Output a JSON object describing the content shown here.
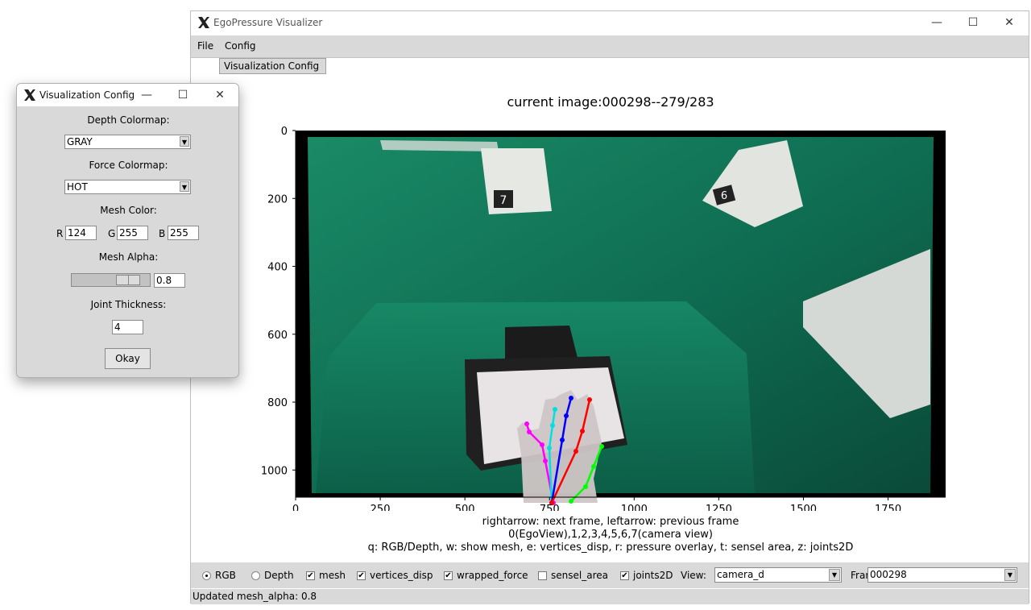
{
  "main_window": {
    "title": "EgoPressure Visualizer",
    "controls": {
      "minimize": "—",
      "maximize": "☐",
      "close": "✕"
    },
    "menu": [
      "File",
      "Config"
    ],
    "dropdown_item": "Visualization Config"
  },
  "plot": {
    "title": "current image:000298--279/283",
    "x_ticks": [
      "0",
      "250",
      "500",
      "750",
      "1000",
      "1250",
      "1500",
      "1750"
    ],
    "y_ticks": [
      "0",
      "200",
      "400",
      "600",
      "800",
      "1000"
    ],
    "markers": [
      "7",
      "6"
    ],
    "captions": [
      "rightarrow: next frame, leftarrow: previous frame",
      "0(EgoView),1,2,3,4,5,6,7(camera view)",
      "q: RGB/Depth, w: show mesh, e: vertices_disp, r: pressure overlay, t: sensel area, z: joints2D"
    ],
    "hand_colors": {
      "thumb": "#ff00ff",
      "index": "#00e0e0",
      "middle": "#0000ff",
      "ring": "#ff0000",
      "pinky": "#00ff00"
    }
  },
  "bottom_controls": {
    "rgb": "RGB",
    "depth": "Depth",
    "mesh": "mesh",
    "vertices_disp": "vertices_disp",
    "wrapped_force": "wrapped_force",
    "sensel_area": "sensel_area",
    "joints2d": "joints2D",
    "view_label": "View:",
    "view_value": "camera_d",
    "frame_label": "Frame:",
    "frame_value": "000298",
    "check_mark": "✔"
  },
  "status": "Updated mesh_alpha: 0.8",
  "config_window": {
    "title": "Visualization Config",
    "depth_colormap_label": "Depth Colormap:",
    "depth_colormap_value": "GRAY",
    "force_colormap_label": "Force Colormap:",
    "force_colormap_value": "HOT",
    "mesh_color_label": "Mesh Color:",
    "r_label": "R",
    "r_value": "124",
    "g_label": "G",
    "g_value": "255",
    "b_label": "B",
    "b_value": "255",
    "mesh_alpha_label": "Mesh Alpha:",
    "mesh_alpha_value": "0.8",
    "joint_thickness_label": "Joint Thickness:",
    "joint_thickness_value": "4",
    "okay_label": "Okay"
  }
}
